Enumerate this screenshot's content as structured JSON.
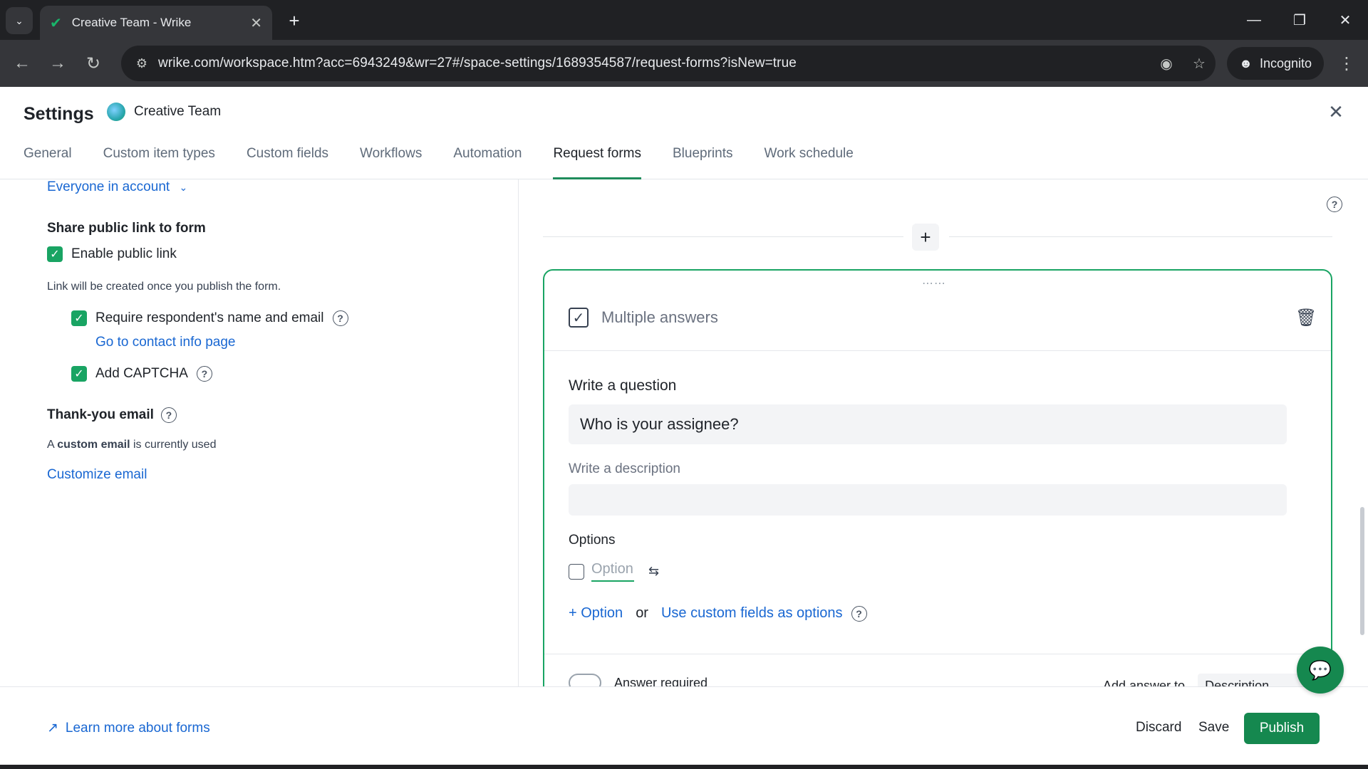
{
  "browser": {
    "tab_title": "Creative Team - Wrike",
    "url": "wrike.com/workspace.htm?acc=6943249&wr=27#/space-settings/1689354587/request-forms?isNew=true",
    "incognito_label": "Incognito"
  },
  "header": {
    "title": "Settings",
    "space_name": "Creative Team",
    "tabs": [
      {
        "label": "General"
      },
      {
        "label": "Custom item types"
      },
      {
        "label": "Custom fields"
      },
      {
        "label": "Workflows"
      },
      {
        "label": "Automation"
      },
      {
        "label": "Request forms",
        "active": true
      },
      {
        "label": "Blueprints"
      },
      {
        "label": "Work schedule"
      }
    ]
  },
  "left": {
    "audience_dropdown": "Everyone in account",
    "share_heading": "Share public link to form",
    "enable_public_link": "Enable public link",
    "link_note": "Link will be created once you publish the form.",
    "require_name_email": "Require respondent's name and email",
    "contact_info_link": "Go to contact info page",
    "captcha": "Add CAPTCHA",
    "thank_you_heading": "Thank-you email",
    "custom_email_prefix": "A",
    "custom_email_bold": "custom email",
    "custom_email_suffix": "is currently used",
    "customize_email": "Customize email"
  },
  "card": {
    "type_label": "Multiple answers",
    "question_label": "Write a question",
    "question_value": "Who is your assignee?",
    "description_label": "Write a description",
    "description_value": "",
    "options_label": "Options",
    "option_placeholder": "Option",
    "add_option": "Option",
    "or_text": "or",
    "custom_fields_link": "Use custom fields as options",
    "answer_required": "Answer required",
    "add_answer_to": "Add answer to",
    "add_answer_select": "Description"
  },
  "footer": {
    "learn_more": "Learn more about forms",
    "discard": "Discard",
    "save": "Save",
    "publish": "Publish"
  },
  "colors": {
    "accent_green": "#19a463",
    "publish_green": "#15884f",
    "link_blue": "#1967d2"
  }
}
